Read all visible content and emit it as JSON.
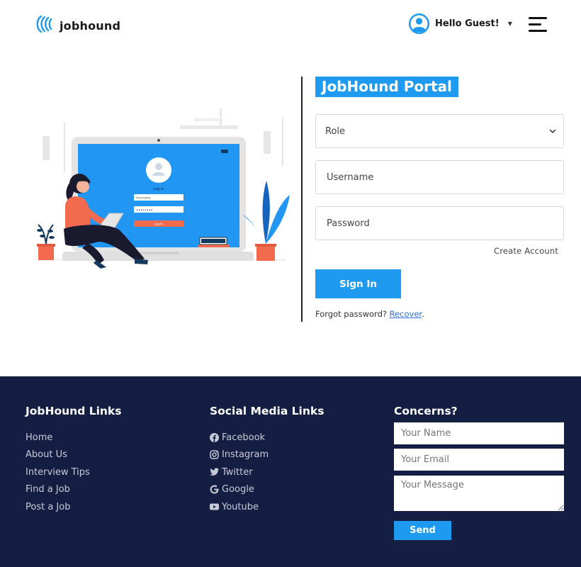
{
  "header": {
    "brand": "jobhound",
    "greeting": "Hello Guest!",
    "icons": {
      "logo": "jobhound-logo-icon",
      "avatar": "user-avatar-icon",
      "caret": "caret-down-icon",
      "menu": "hamburger-menu-icon"
    }
  },
  "illustration": {
    "login_title": "Log In",
    "username_label": "Username",
    "password_dots": "••••••••",
    "login_button": "Log In"
  },
  "form": {
    "title": "JobHound Portal",
    "role_placeholder": "Role",
    "username_placeholder": "Username",
    "password_placeholder": "Password",
    "create_account": "Create Account",
    "sign_in": "Sign In",
    "forgot_text": "Forgot password?",
    "recover": "Recover",
    "recover_suffix": "."
  },
  "footer": {
    "links_title": "JobHound Links",
    "links": [
      "Home",
      "About Us",
      "Interview Tips",
      "Find a Job",
      "Post a Job"
    ],
    "social_title": "Social Media Links",
    "social": [
      {
        "label": "Facebook",
        "icon": "facebook-icon"
      },
      {
        "label": "Instagram",
        "icon": "instagram-icon"
      },
      {
        "label": "Twitter",
        "icon": "twitter-icon"
      },
      {
        "label": "Google",
        "icon": "google-icon"
      },
      {
        "label": "Youtube",
        "icon": "youtube-icon"
      }
    ],
    "concerns_title": "Concerns?",
    "name_placeholder": "Your Name",
    "email_placeholder": "Your Email",
    "message_placeholder": "Your Message",
    "send": "Send"
  },
  "colors": {
    "accent": "#1e9bf0",
    "footer_bg": "#141e42",
    "link_color": "#2e6fd8",
    "illustration_screen": "#2196f3",
    "illustration_shirt": "#f26b4f"
  }
}
